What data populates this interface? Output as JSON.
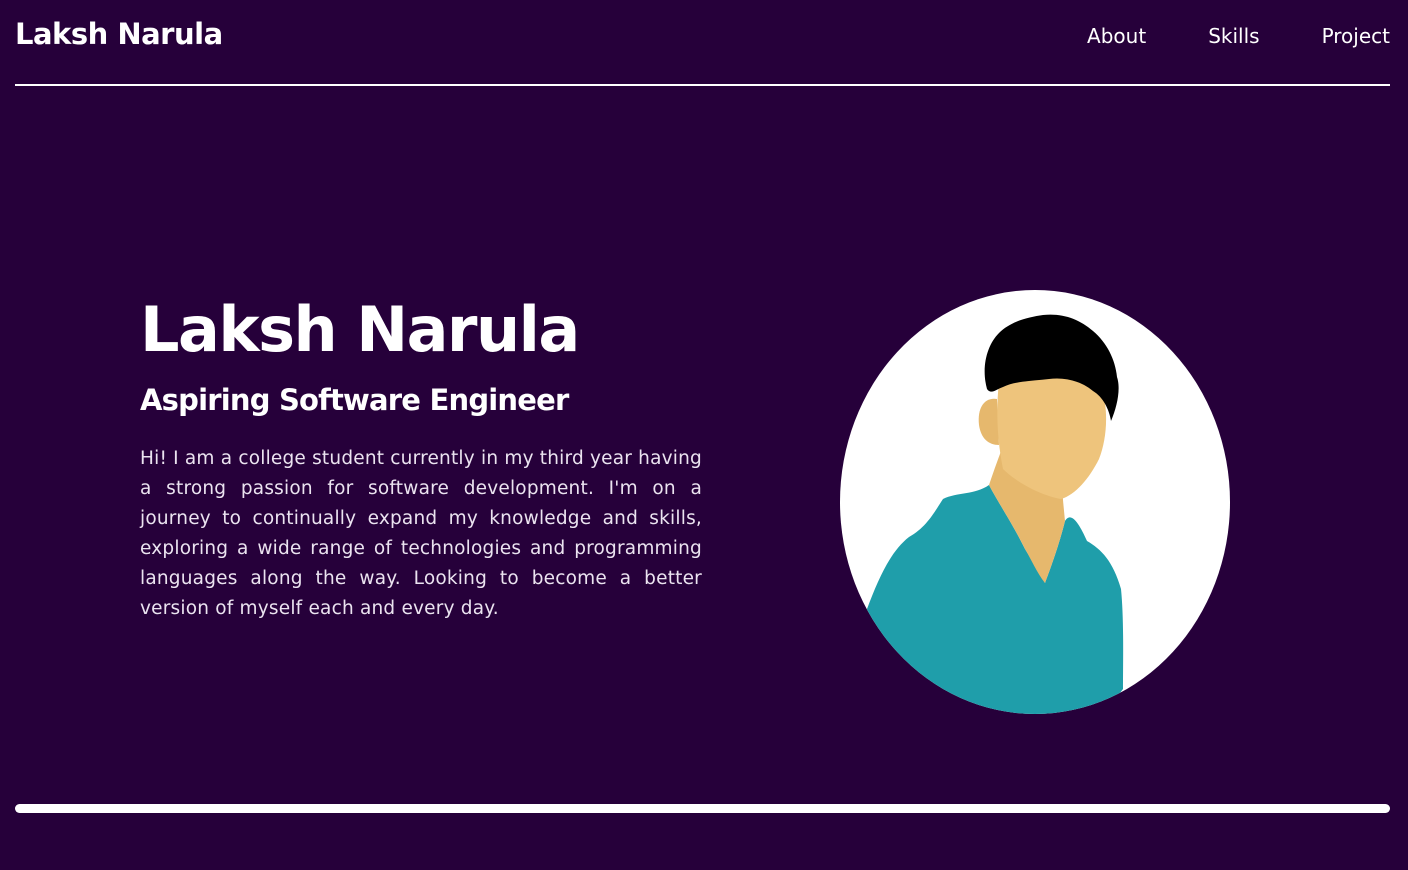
{
  "header": {
    "brand": "Laksh Narula",
    "nav": [
      {
        "label": "About"
      },
      {
        "label": "Skills"
      },
      {
        "label": "Project"
      }
    ]
  },
  "hero": {
    "name": "Laksh Narula",
    "role": "Aspiring Software Engineer",
    "bio": "Hi! I am a college student currently in my third year having a strong passion for software development. I'm on a journey to continually expand my knowledge and skills, exploring a wide range of technologies and programming languages along the way. Looking to become a better version of myself each and every day.",
    "avatar_icon": "person-avatar-illustration"
  },
  "colors": {
    "background": "#26003a",
    "text": "#ffffff",
    "shirt": "#1f9eaa",
    "skin": "#eec47c",
    "hair": "#000000"
  }
}
